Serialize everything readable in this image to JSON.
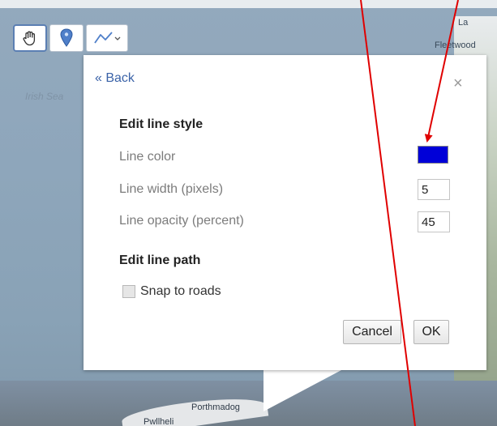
{
  "map": {
    "sea_label": "Irish Sea",
    "town_right_top": "Fleetwood",
    "town_right_top_partial": "La",
    "town_bottom": "Porthmadog",
    "town_bottom_left": "Pwllheli"
  },
  "toolbar": {
    "hand_icon": "hand-icon",
    "marker_icon": "map-marker-icon",
    "line_icon": "line-draw-icon",
    "dropdown_icon": "chevron-down-icon"
  },
  "dialog": {
    "back_label": "« Back",
    "close_label": "×",
    "style_section_title": "Edit line style",
    "line_color_label": "Line color",
    "line_color_value": "#0000d8",
    "line_width_label": "Line width (pixels)",
    "line_width_value": "5",
    "line_opacity_label": "Line opacity (percent)",
    "line_opacity_value": "45",
    "path_section_title": "Edit line path",
    "snap_label": "Snap to roads",
    "snap_checked": false,
    "cancel_label": "Cancel",
    "ok_label": "OK"
  },
  "annotation_color": "#e00000"
}
